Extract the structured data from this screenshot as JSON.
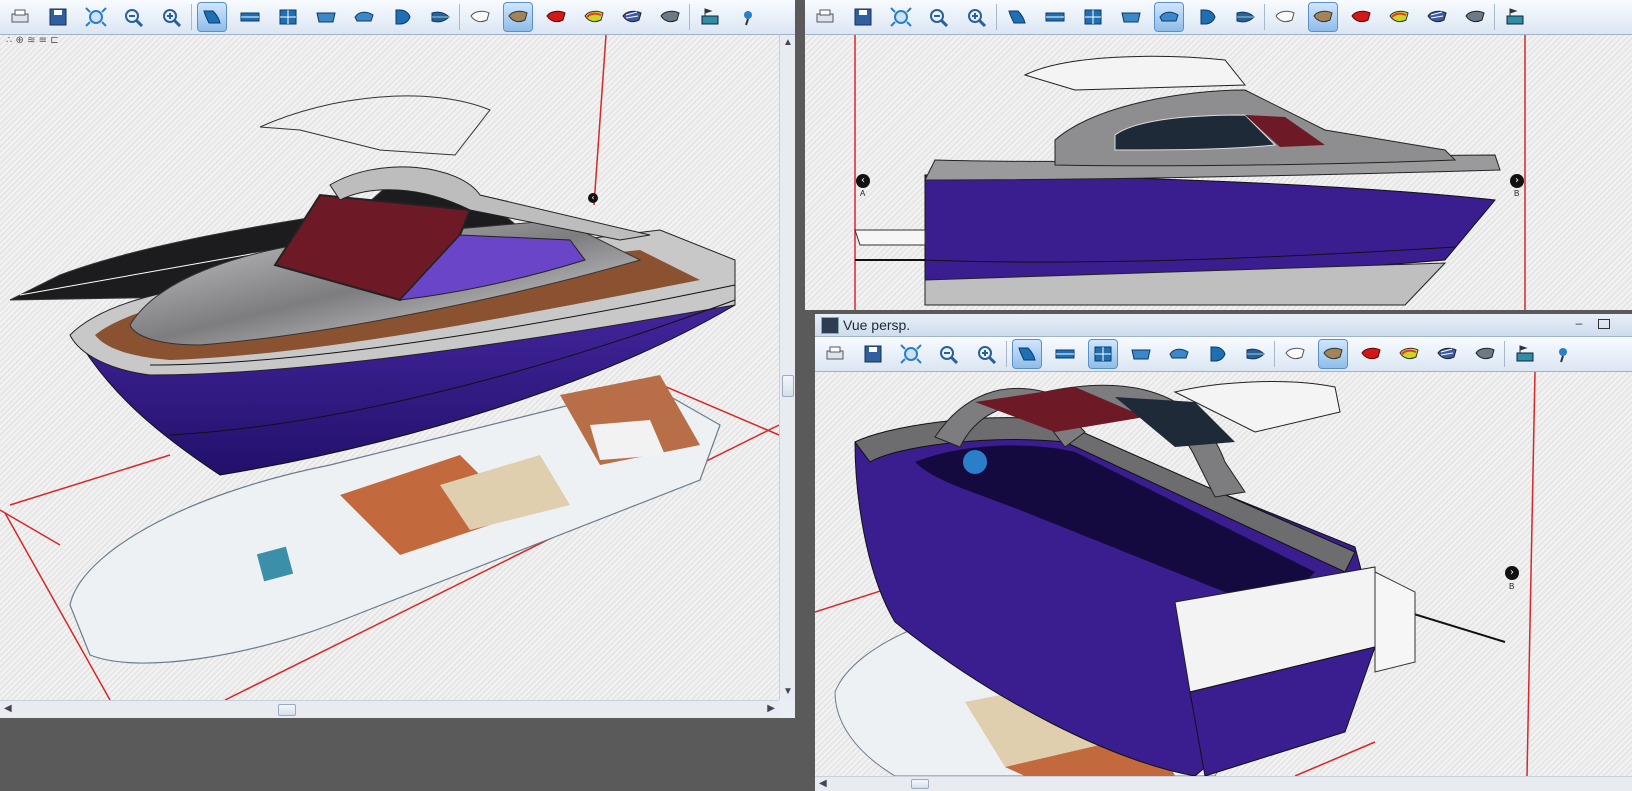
{
  "left_window": {
    "toolbar_groups": [
      [
        "print",
        "save",
        "zoom-fit",
        "zoom-out",
        "zoom-in"
      ],
      [
        "view-hull",
        "view-plan",
        "view-body",
        "view-profile",
        "view-deck",
        "view-half",
        "view-half-shaded"
      ],
      [
        "render-wire",
        "render-shaded",
        "render-red",
        "render-curvature",
        "render-stripes",
        "render-grey"
      ],
      [
        "layers",
        "pin"
      ]
    ],
    "active_tools": [
      "view-hull",
      "render-shaded"
    ],
    "corner_glyphs": "∴ ⊕ ≋ ≡ ⊏"
  },
  "top_right_window": {
    "toolbar_groups": [
      [
        "print",
        "save",
        "zoom-fit",
        "zoom-out",
        "zoom-in"
      ],
      [
        "view-hull",
        "view-plan",
        "view-body",
        "view-profile",
        "view-deck",
        "view-half",
        "view-half-shaded"
      ],
      [
        "render-wire",
        "render-shaded",
        "render-red",
        "render-curvature",
        "render-stripes",
        "render-grey"
      ],
      [
        "layers"
      ]
    ],
    "active_tools": [
      "view-deck",
      "render-shaded"
    ],
    "markers": [
      {
        "symbol": "‹",
        "label": "A"
      },
      {
        "symbol": "›",
        "label": "B"
      }
    ]
  },
  "persp_window": {
    "title": "Vue persp.",
    "toolbar_groups": [
      [
        "print",
        "save",
        "zoom-fit",
        "zoom-out",
        "zoom-in"
      ],
      [
        "view-hull",
        "view-plan",
        "view-body",
        "view-profile",
        "view-deck",
        "view-half",
        "view-half-shaded"
      ],
      [
        "render-wire",
        "render-shaded",
        "render-red",
        "render-curvature",
        "render-stripes",
        "render-grey"
      ],
      [
        "layers",
        "pin"
      ]
    ],
    "active_tools": [
      "view-hull",
      "view-body",
      "render-shaded"
    ],
    "markers": [
      {
        "symbol": "›",
        "label": "B"
      }
    ]
  },
  "colors": {
    "hull_purple": "#3a1e8f",
    "deck_grey": "#8d8d8f",
    "window_red": "#6e1a26",
    "teak": "#b86f47",
    "red_guides": "#d62828",
    "toolbar_accent": "#2a7fc9"
  }
}
